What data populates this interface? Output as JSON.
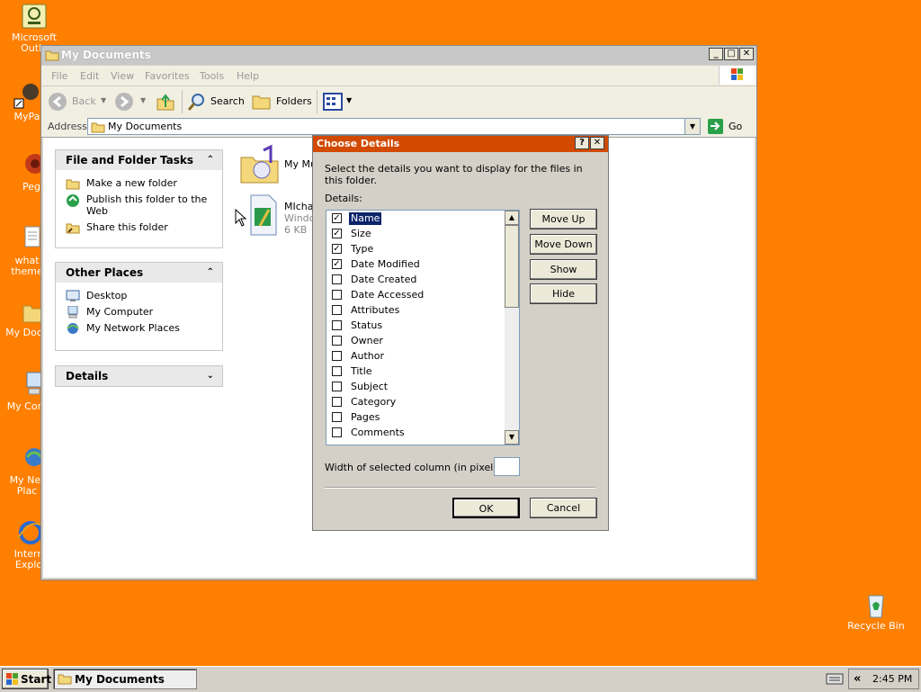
{
  "desktop": {
    "icons": [
      {
        "label_line1": "Microsoft",
        "label_line2": "Outlo"
      },
      {
        "label_line1": "MyPa",
        "label_line2": ""
      },
      {
        "label_line1": "Peg",
        "label_line2": ""
      },
      {
        "label_line1": "what",
        "label_line2": "theme"
      },
      {
        "label_line1": "My Docu",
        "label_line2": ""
      },
      {
        "label_line1": "My Com",
        "label_line2": ""
      },
      {
        "label_line1": "My Net",
        "label_line2": "Plac"
      },
      {
        "label_line1": "Intern",
        "label_line2": "Explo"
      }
    ],
    "recycle_bin": "Recycle Bin"
  },
  "window": {
    "title": "My Documents",
    "menu": [
      "File",
      "Edit",
      "View",
      "Favorites",
      "Tools",
      "Help"
    ],
    "toolbar": {
      "back": "Back",
      "search": "Search",
      "folders": "Folders"
    },
    "address": {
      "label": "Address",
      "value": "My Documents",
      "go": "Go"
    },
    "panels": {
      "file_tasks": {
        "title": "File and Folder Tasks",
        "items": [
          "Make a new folder",
          "Publish this folder to the Web",
          "Share this folder"
        ]
      },
      "other_places": {
        "title": "Other Places",
        "items": [
          "Desktop",
          "My Computer",
          "My Network Places"
        ]
      },
      "details": {
        "title": "Details"
      }
    },
    "files": [
      {
        "name": "My Mu",
        "sub": "",
        "size": ""
      },
      {
        "name": "MIchae",
        "sub": "Windo",
        "size": "6 KB"
      }
    ]
  },
  "dialog": {
    "title": "Choose Details",
    "instruction": "Select the details you want to display for the files in this folder.",
    "details_label": "Details:",
    "items": [
      {
        "label": "Name",
        "checked": true,
        "selected": true
      },
      {
        "label": "Size",
        "checked": true,
        "selected": false
      },
      {
        "label": "Type",
        "checked": true,
        "selected": false
      },
      {
        "label": "Date Modified",
        "checked": true,
        "selected": false
      },
      {
        "label": "Date Created",
        "checked": false,
        "selected": false
      },
      {
        "label": "Date Accessed",
        "checked": false,
        "selected": false
      },
      {
        "label": "Attributes",
        "checked": false,
        "selected": false
      },
      {
        "label": "Status",
        "checked": false,
        "selected": false
      },
      {
        "label": "Owner",
        "checked": false,
        "selected": false
      },
      {
        "label": "Author",
        "checked": false,
        "selected": false
      },
      {
        "label": "Title",
        "checked": false,
        "selected": false
      },
      {
        "label": "Subject",
        "checked": false,
        "selected": false
      },
      {
        "label": "Category",
        "checked": false,
        "selected": false
      },
      {
        "label": "Pages",
        "checked": false,
        "selected": false
      },
      {
        "label": "Comments",
        "checked": false,
        "selected": false
      }
    ],
    "buttons": {
      "move_up": "Move Up",
      "move_down": "Move Down",
      "show": "Show",
      "hide": "Hide",
      "ok": "OK",
      "cancel": "Cancel"
    },
    "width_label": "Width of selected column (in pixels):",
    "width_value": ""
  },
  "taskbar": {
    "start": "Start",
    "task": "My Documents",
    "clock": "2:45 PM",
    "tray_expand": "«"
  },
  "colors": {
    "desktop": "#ff7f00",
    "dialog_title": "#d24a00",
    "selection": "#0a246a"
  }
}
